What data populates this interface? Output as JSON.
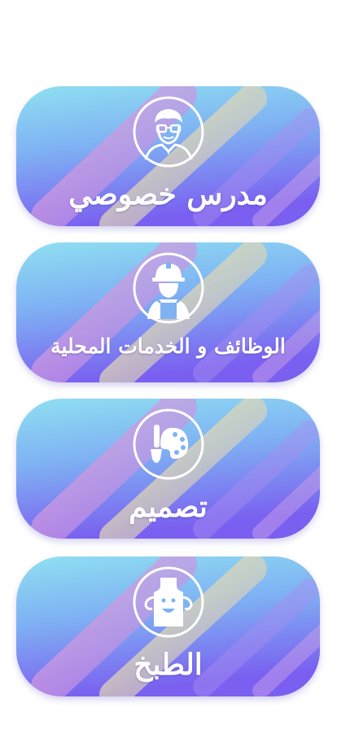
{
  "categories": [
    {
      "label": "مدرس خصوصي",
      "icon": "teacher-icon"
    },
    {
      "label": "الوظائف و الخدمات المحلية",
      "icon": "worker-icon"
    },
    {
      "label": "تصميم",
      "icon": "palette-icon"
    },
    {
      "label": "الطبخ",
      "icon": "chef-apron-icon"
    }
  ],
  "colors": {
    "gradient_top": "#8cdcf3",
    "gradient_mid": "#7d9ef2",
    "gradient_bottom": "#7e5ef0",
    "stripe_pink": "#d79bd8",
    "stripe_yellow": "#e7dfa8",
    "label_text": "#ffffff"
  }
}
